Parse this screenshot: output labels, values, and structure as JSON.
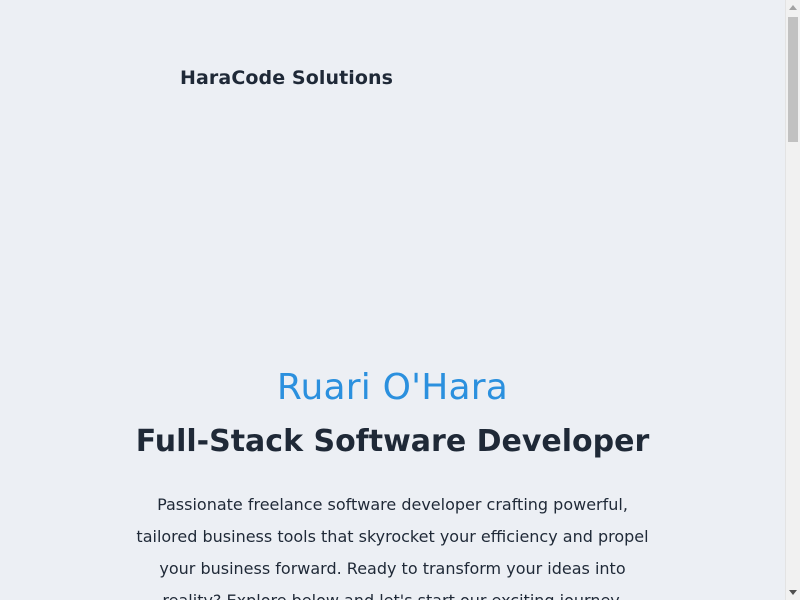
{
  "header": {
    "brand": "HaraCode Solutions"
  },
  "hero": {
    "name": "Ruari O'Hara",
    "role": "Full-Stack Software Developer",
    "description": "Passionate freelance software developer crafting powerful, tailored business tools that skyrocket your efficiency and propel your business forward. Ready to transform your ideas into reality? Explore below and let's start our exciting journey."
  },
  "colors": {
    "background": "#eceff4",
    "accent": "#2b90de",
    "text": "#1f2937"
  },
  "scrollbar": {
    "position_fraction": 0.0
  }
}
